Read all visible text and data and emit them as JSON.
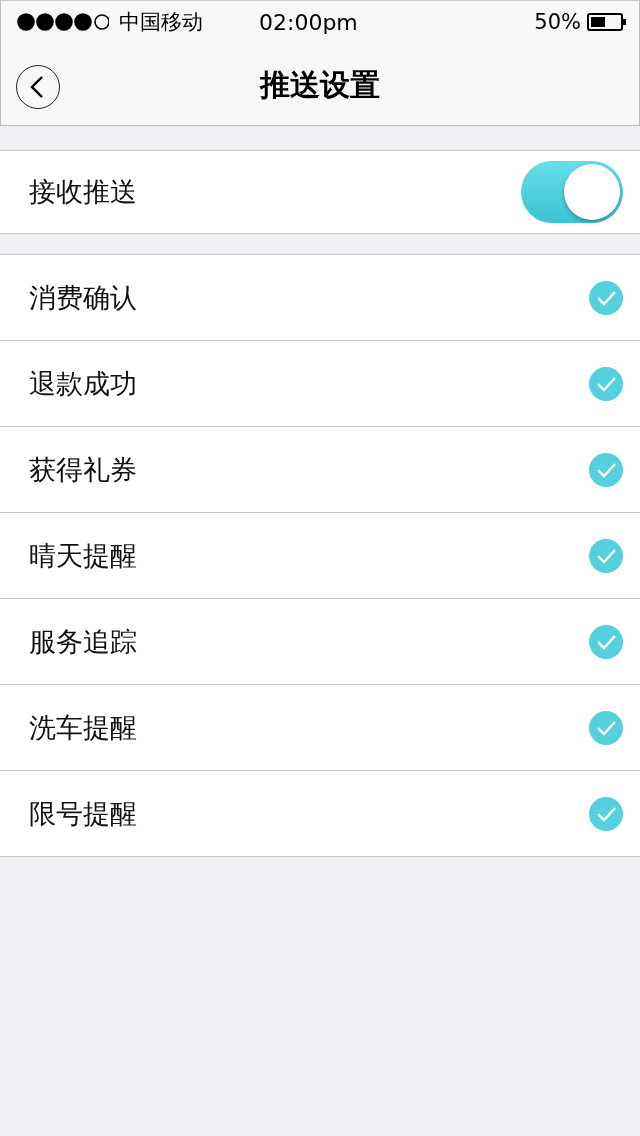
{
  "status_bar": {
    "carrier": "中国移动",
    "time": "02:00pm",
    "battery": "50%"
  },
  "nav": {
    "title": "推送设置"
  },
  "push_toggle": {
    "label": "接收推送",
    "on": true
  },
  "items": [
    {
      "label": "消费确认",
      "checked": true
    },
    {
      "label": "退款成功",
      "checked": true
    },
    {
      "label": "获得礼券",
      "checked": true
    },
    {
      "label": "晴天提醒",
      "checked": true
    },
    {
      "label": "服务追踪",
      "checked": true
    },
    {
      "label": "洗车提醒",
      "checked": true
    },
    {
      "label": "限号提醒",
      "checked": true
    }
  ]
}
